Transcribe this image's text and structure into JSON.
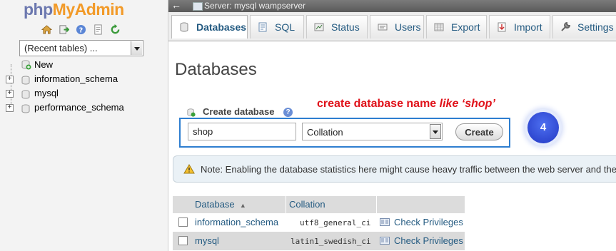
{
  "nav": {
    "logo_php": "php",
    "logo_myadmin": "MyAdmin",
    "icons": [
      "home-icon",
      "logout-icon",
      "help-icon",
      "docs-icon",
      "reload-icon"
    ],
    "recent_tables": "(Recent tables) ...",
    "tree": [
      {
        "label": "New",
        "expandable": false
      },
      {
        "label": "information_schema",
        "expandable": true
      },
      {
        "label": "mysql",
        "expandable": true
      },
      {
        "label": "performance_schema",
        "expandable": true
      }
    ]
  },
  "topbar": {
    "back": "←",
    "server": "Server: mysql wampserver"
  },
  "tabs": [
    {
      "label": "Databases",
      "icon": "database-icon",
      "active": true
    },
    {
      "label": "SQL",
      "icon": "sql-icon",
      "active": false
    },
    {
      "label": "Status",
      "icon": "status-icon",
      "active": false
    },
    {
      "label": "Users",
      "icon": "users-icon",
      "active": false
    },
    {
      "label": "Export",
      "icon": "export-icon",
      "active": false
    },
    {
      "label": "Import",
      "icon": "import-icon",
      "active": false
    },
    {
      "label": "Settings",
      "icon": "settings-icon",
      "active": false
    }
  ],
  "page_title": "Databases",
  "annotation": {
    "text": "create database name ",
    "italic": "like ‘shop’"
  },
  "create": {
    "label": "Create database",
    "name_value": "shop",
    "collation_value": "Collation",
    "button_label": "Create",
    "step": "4"
  },
  "notice": "Note: Enabling the database statistics here might cause heavy traffic between the web server and the",
  "table": {
    "headers": [
      "Database",
      "Collation"
    ],
    "sort_arrow": "▲",
    "rows": [
      {
        "database": "information_schema",
        "collation": "utf8_general_ci",
        "action": "Check Privileges"
      },
      {
        "database": "mysql",
        "collation": "latin1_swedish_ci",
        "action": "Check Privileges"
      }
    ]
  },
  "colors": {
    "link": "#235a81",
    "annotation": "#e0121a",
    "highlight_border": "#2e7ed0",
    "step_badge": "#2f4fe0"
  }
}
